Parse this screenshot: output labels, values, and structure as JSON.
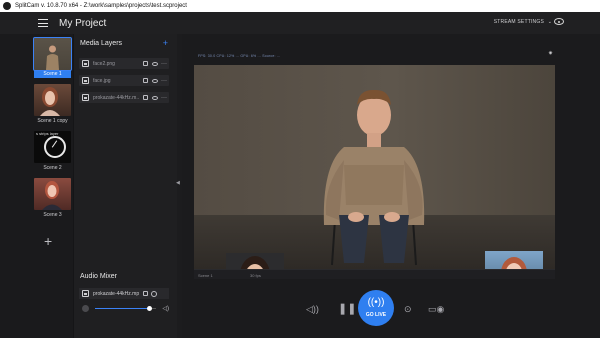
{
  "titlebar": {
    "title": "SplitCam v. 10.8.70 x64 - Z:\\work\\samples\\projects\\test.scproject"
  },
  "header": {
    "project_title": "My Project",
    "stream_settings": "STREAM SETTINGS",
    "chevron": "⌄"
  },
  "scenes": [
    {
      "label": "Scene 1"
    },
    {
      "label": "Scene 1 copy"
    },
    {
      "label": "Scene 2",
      "overlay_text": "s strips layer"
    },
    {
      "label": "Scene 3"
    }
  ],
  "scenes_add": "+",
  "media_layers": {
    "title": "Media Layers",
    "add": "+",
    "items": [
      {
        "name": "face2.png"
      },
      {
        "name": "face.jpg"
      },
      {
        "name": "prokazate-44kHz.m..."
      }
    ]
  },
  "audio_mixer": {
    "title": "Audio Mixer",
    "source_name": "prokazate-44kHz.mp4",
    "volume_fraction": 0.9
  },
  "preview": {
    "top_info": "FPS: 30.0   CPU: 12%   ...   GPU: 6%   ...   Source: ...",
    "footer_scene": "Scene 1",
    "footer_fps": "30 fps"
  },
  "controls": {
    "go_live_label": "GO LIVE"
  },
  "colors": {
    "accent": "#2f7ff0",
    "background": "#1c1c1e",
    "panel": "#1f1f21"
  },
  "icons": {
    "menu": "hamburger-icon",
    "eye": "eye-icon",
    "brightness": "sun-icon",
    "volume": "speaker-icon",
    "pause": "pause-icon",
    "broadcast": "broadcast-icon",
    "camera": "camera-icon",
    "record": "video-record-icon"
  }
}
